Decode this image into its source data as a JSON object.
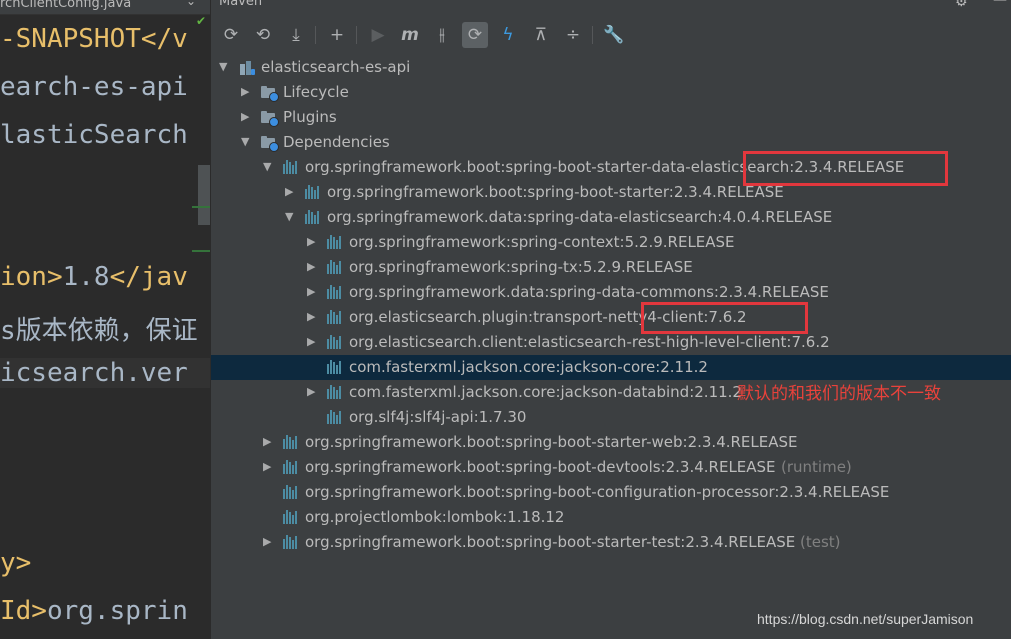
{
  "editor": {
    "tab_label": "rchClientConfig.java",
    "tab_chevron": "⌄",
    "lines": [
      {
        "pre": "",
        "tag": "-SNAPSHOT</v",
        "post": ""
      },
      {
        "pre": "earch-es-api",
        "tag": "",
        "post": ""
      },
      {
        "pre": "lasticSearch",
        "tag": "",
        "post": ""
      },
      {
        "pre": "",
        "tag": "ion>",
        "post": "1.8",
        "tag2": "</jav"
      },
      {
        "comment": "s版本依赖，保证"
      },
      {
        "pre": "icsearch.ver",
        "tag": "",
        "post": ""
      },
      {
        "pre": "",
        "tag": "y>",
        "post": ""
      },
      {
        "pre": "",
        "tag": "Id>",
        "post": "org.sprin"
      }
    ]
  },
  "maven": {
    "title": "Maven",
    "toolbar": [
      {
        "name": "reload-all-icon",
        "glyph": "⟳"
      },
      {
        "name": "generate-sources-icon",
        "glyph": "⟲"
      },
      {
        "name": "download-sources-icon",
        "glyph": "⤓"
      },
      {
        "name": "add-project-icon",
        "glyph": "+"
      },
      {
        "name": "run-icon",
        "glyph": "▶"
      },
      {
        "name": "execute-goal-icon",
        "glyph": "m"
      },
      {
        "name": "toggle-offline-icon",
        "glyph": "⫲"
      },
      {
        "name": "skip-tests-icon",
        "glyph": "⟳"
      },
      {
        "name": "show-dependencies-icon",
        "glyph": "ϟ"
      },
      {
        "name": "collapse-all-icon",
        "glyph": "⊼"
      },
      {
        "name": "expand-all-icon",
        "glyph": "÷"
      },
      {
        "name": "settings-wrench-icon",
        "glyph": "🔧"
      }
    ],
    "tree": [
      {
        "level": 0,
        "arrow": "expanded",
        "icon": "maven",
        "label": "elasticsearch-es-api"
      },
      {
        "level": 1,
        "arrow": "collapsed",
        "icon": "folder",
        "label": "Lifecycle"
      },
      {
        "level": 1,
        "arrow": "collapsed",
        "icon": "folder",
        "label": "Plugins"
      },
      {
        "level": 1,
        "arrow": "expanded",
        "icon": "folder",
        "label": "Dependencies"
      },
      {
        "level": 2,
        "arrow": "expanded",
        "icon": "lib",
        "label": "org.springframework.boot:spring-boot-starter-data-elasticsearch:2.3.4.RELEASE"
      },
      {
        "level": 3,
        "arrow": "collapsed",
        "icon": "lib",
        "label": "org.springframework.boot:spring-boot-starter:2.3.4.RELEASE"
      },
      {
        "level": 3,
        "arrow": "expanded",
        "icon": "lib",
        "label": "org.springframework.data:spring-data-elasticsearch:4.0.4.RELEASE"
      },
      {
        "level": 4,
        "arrow": "collapsed",
        "icon": "lib",
        "label": "org.springframework:spring-context:5.2.9.RELEASE"
      },
      {
        "level": 4,
        "arrow": "collapsed",
        "icon": "lib",
        "label": "org.springframework:spring-tx:5.2.9.RELEASE"
      },
      {
        "level": 4,
        "arrow": "collapsed",
        "icon": "lib",
        "label": "org.springframework.data:spring-data-commons:2.3.4.RELEASE"
      },
      {
        "level": 4,
        "arrow": "collapsed",
        "icon": "lib",
        "label": "org.elasticsearch.plugin:transport-netty4-client:7.6.2"
      },
      {
        "level": 4,
        "arrow": "collapsed",
        "icon": "lib",
        "label": "org.elasticsearch.client:elasticsearch-rest-high-level-client:7.6.2"
      },
      {
        "level": 4,
        "arrow": "none",
        "icon": "lib",
        "label": "com.fasterxml.jackson.core:jackson-core:2.11.2",
        "selected": true
      },
      {
        "level": 4,
        "arrow": "collapsed",
        "icon": "lib",
        "label": "com.fasterxml.jackson.core:jackson-databind:2.11.2"
      },
      {
        "level": 4,
        "arrow": "none",
        "icon": "lib",
        "label": "org.slf4j:slf4j-api:1.7.30"
      },
      {
        "level": 2,
        "arrow": "collapsed",
        "icon": "lib",
        "label": "org.springframework.boot:spring-boot-starter-web:2.3.4.RELEASE"
      },
      {
        "level": 2,
        "arrow": "collapsed",
        "icon": "lib",
        "label": "org.springframework.boot:spring-boot-devtools:2.3.4.RELEASE",
        "scope": "(runtime)"
      },
      {
        "level": 2,
        "arrow": "none",
        "icon": "lib",
        "label": "org.springframework.boot:spring-boot-configuration-processor:2.3.4.RELEASE"
      },
      {
        "level": 2,
        "arrow": "none",
        "icon": "lib",
        "label": "org.projectlombok:lombok:1.18.12"
      },
      {
        "level": 2,
        "arrow": "collapsed",
        "icon": "lib",
        "label": "org.springframework.boot:spring-boot-starter-test:2.3.4.RELEASE",
        "scope": "(test)"
      }
    ]
  },
  "annotation": "默认的和我们的版本不一致",
  "watermark": "https://blog.csdn.net/superJamison",
  "colors": {
    "highlight_box": "#e2373d",
    "selection": "#0d293e",
    "annotation_text": "#e9423b"
  }
}
